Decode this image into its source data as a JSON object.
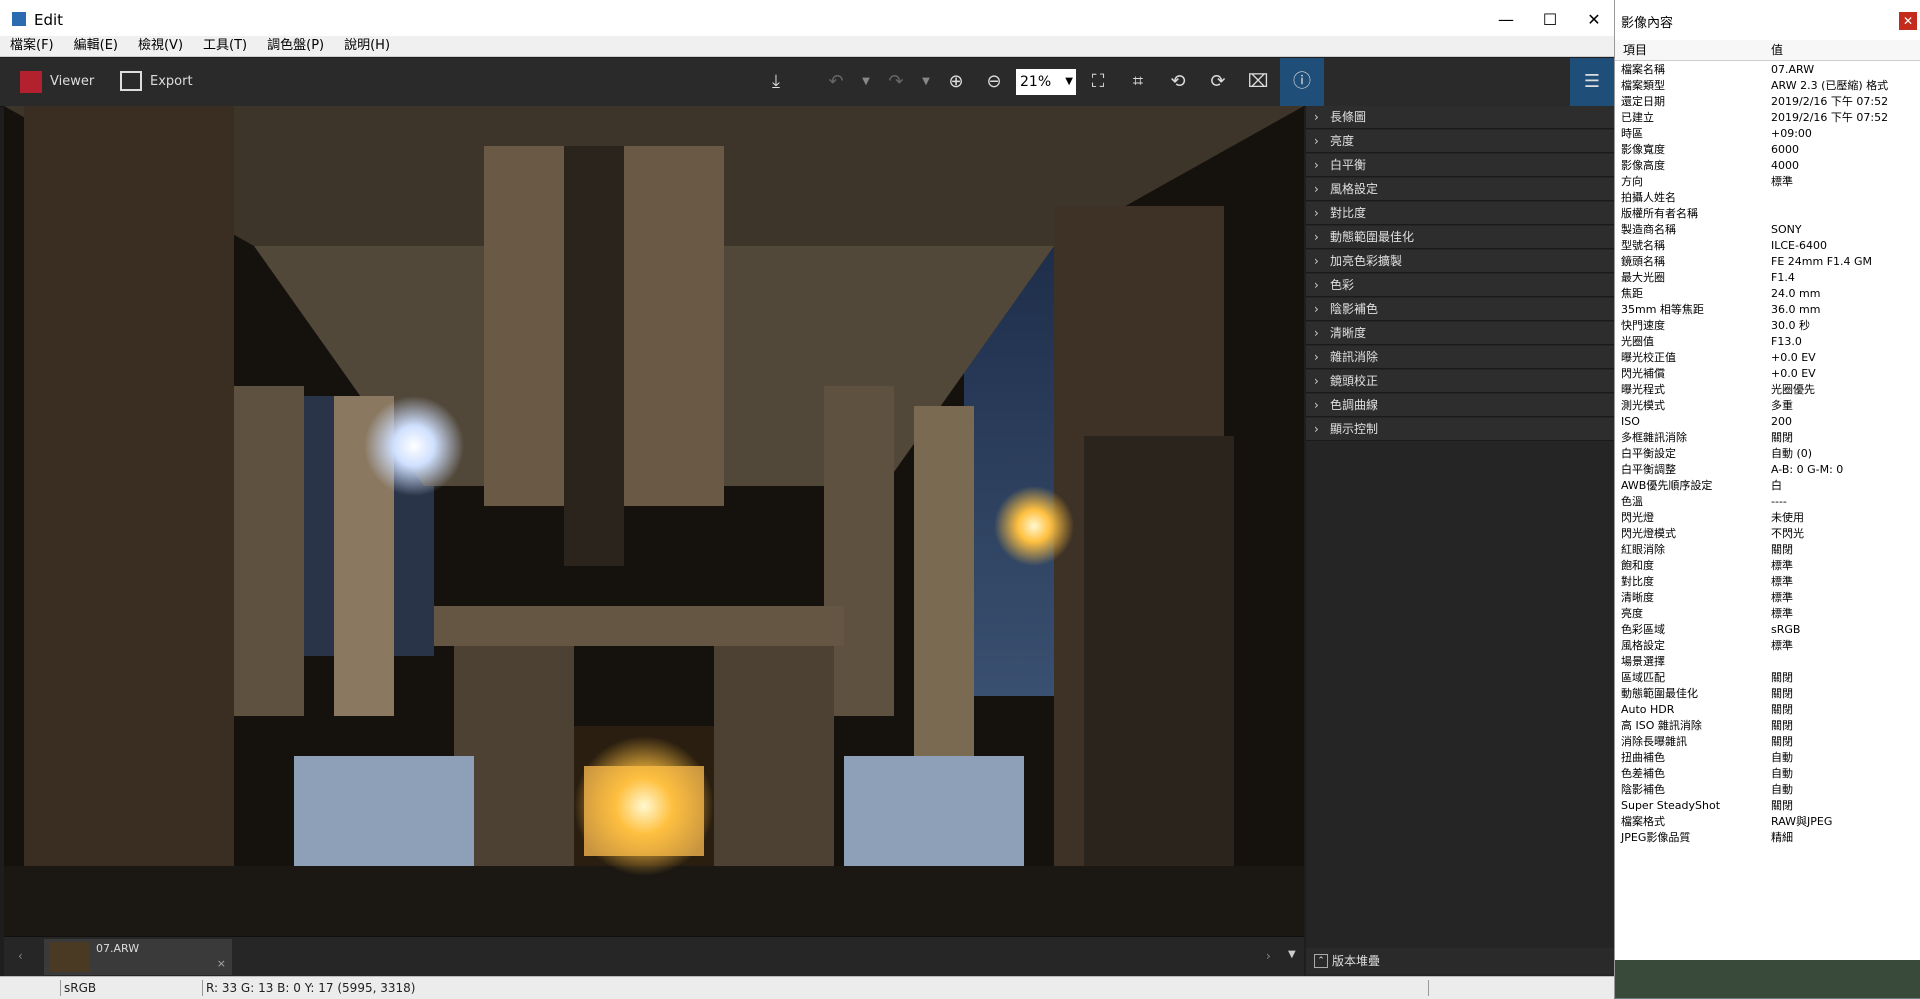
{
  "window": {
    "title": "Edit",
    "minimize": "—",
    "maximize": "☐",
    "close": "✕"
  },
  "menu": [
    "檔案(F)",
    "編輯(E)",
    "檢視(V)",
    "工具(T)",
    "調色盤(P)",
    "說明(H)"
  ],
  "toolbar": {
    "viewer_label": "Viewer",
    "export_label": "Export",
    "zoom_value": "21%"
  },
  "adjustments": [
    "長條圖",
    "亮度",
    "白平衡",
    "風格設定",
    "對比度",
    "動態範圍最佳化",
    "加亮色彩擴製",
    "色彩",
    "陰影補色",
    "清晰度",
    "雜訊消除",
    "鏡頭校正",
    "色調曲線",
    "顯示控制"
  ],
  "version_stack": {
    "label": "版本堆疊"
  },
  "filmstrip": {
    "filename": "07.ARW"
  },
  "status": {
    "colorspace": "sRGB",
    "pixel_info": "R: 33  G: 13  B:  0  Y: 17   (5995, 3318)"
  },
  "properties": {
    "title": "影像內容",
    "col_item": "項目",
    "col_value": "值",
    "rows": [
      {
        "k": "檔案名稱",
        "v": "07.ARW"
      },
      {
        "k": "檔案類型",
        "v": "ARW 2.3 (已壓縮) 格式"
      },
      {
        "k": "還定日期",
        "v": "2019/2/16 下午 07:52"
      },
      {
        "k": "已建立",
        "v": "2019/2/16 下午 07:52"
      },
      {
        "k": "時區",
        "v": "+09:00"
      },
      {
        "k": "影像寬度",
        "v": "6000"
      },
      {
        "k": "影像高度",
        "v": "4000"
      },
      {
        "k": "方向",
        "v": "標準"
      },
      {
        "k": "拍攝人姓名",
        "v": ""
      },
      {
        "k": "版權所有者名稱",
        "v": ""
      },
      {
        "k": "製造商名稱",
        "v": "SONY"
      },
      {
        "k": "型號名稱",
        "v": "ILCE-6400"
      },
      {
        "k": "鏡頭名稱",
        "v": "FE 24mm F1.4 GM"
      },
      {
        "k": "最大光圈",
        "v": "F1.4"
      },
      {
        "k": "焦距",
        "v": "24.0 mm"
      },
      {
        "k": "35mm 相等焦距",
        "v": "36.0 mm"
      },
      {
        "k": "快門速度",
        "v": "30.0 秒"
      },
      {
        "k": "光圈值",
        "v": "F13.0"
      },
      {
        "k": "曝光校正值",
        "v": "+0.0 EV"
      },
      {
        "k": "閃光補償",
        "v": "+0.0 EV"
      },
      {
        "k": "曝光程式",
        "v": "光圈優先"
      },
      {
        "k": "測光模式",
        "v": "多重"
      },
      {
        "k": "ISO",
        "v": "200"
      },
      {
        "k": "多框雜訊消除",
        "v": "關閉"
      },
      {
        "k": "白平衡設定",
        "v": "自動 (0)"
      },
      {
        "k": "白平衡調整",
        "v": "A-B: 0 G-M: 0"
      },
      {
        "k": "AWB優先順序設定",
        "v": "白"
      },
      {
        "k": "色溫",
        "v": "----"
      },
      {
        "k": "閃光燈",
        "v": "未使用"
      },
      {
        "k": "閃光燈模式",
        "v": "不閃光"
      },
      {
        "k": "紅眼消除",
        "v": "關閉"
      },
      {
        "k": "飽和度",
        "v": "標準"
      },
      {
        "k": "對比度",
        "v": "標準"
      },
      {
        "k": "清晰度",
        "v": "標準"
      },
      {
        "k": "亮度",
        "v": "標準"
      },
      {
        "k": "色彩區域",
        "v": "sRGB"
      },
      {
        "k": "風格設定",
        "v": "標準"
      },
      {
        "k": "場景選擇",
        "v": ""
      },
      {
        "k": "區域匹配",
        "v": "關閉"
      },
      {
        "k": "動態範圍最佳化",
        "v": "關閉"
      },
      {
        "k": "Auto HDR",
        "v": "關閉"
      },
      {
        "k": "高 ISO 雜訊消除",
        "v": "關閉"
      },
      {
        "k": "消除長曝雜訊",
        "v": "關閉"
      },
      {
        "k": "扭曲補色",
        "v": "自動"
      },
      {
        "k": "色差補色",
        "v": "自動"
      },
      {
        "k": "陰影補色",
        "v": "自動"
      },
      {
        "k": "Super SteadyShot",
        "v": "關閉"
      },
      {
        "k": "檔案格式",
        "v": "RAW與JPEG"
      },
      {
        "k": "JPEG影像品質",
        "v": "精細"
      }
    ]
  }
}
